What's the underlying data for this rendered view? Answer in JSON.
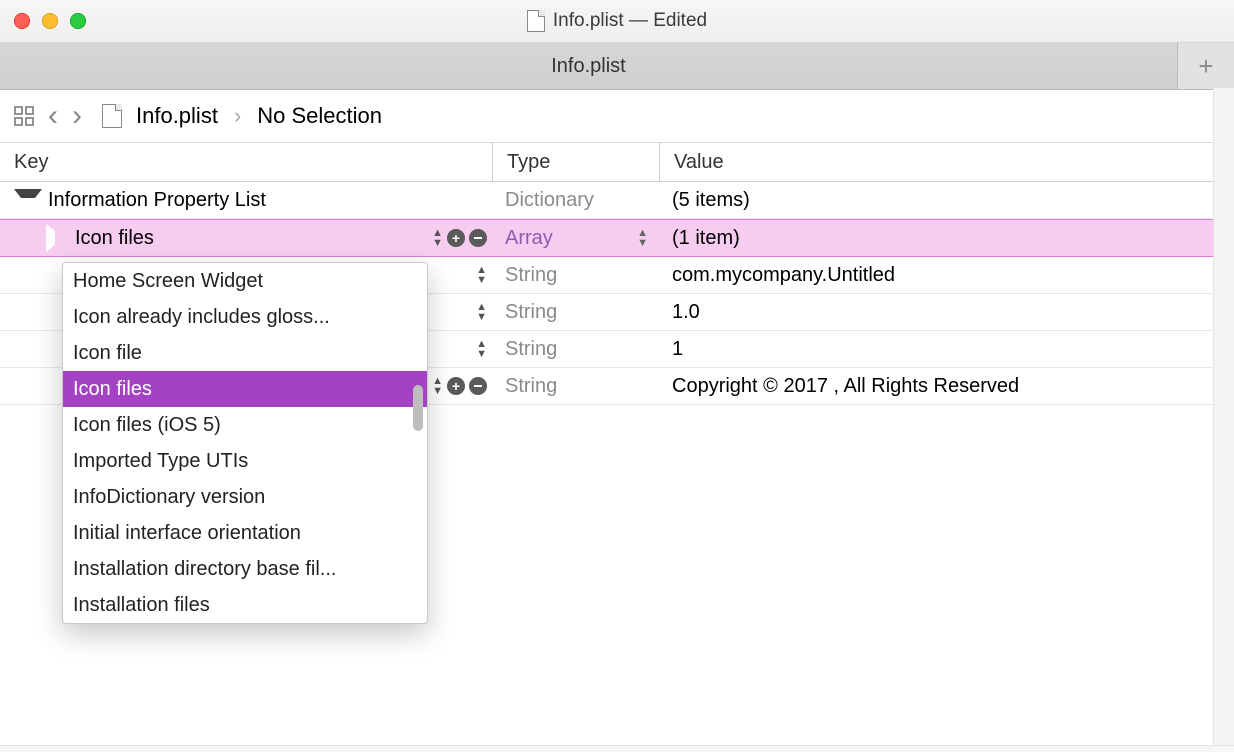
{
  "window": {
    "title": "Info.plist — Edited"
  },
  "tabbar": {
    "tab": "Info.plist"
  },
  "nav": {
    "file": "Info.plist",
    "breadcrumb": "No Selection"
  },
  "columns": {
    "key": "Key",
    "type": "Type",
    "value": "Value"
  },
  "rows": [
    {
      "key": "Information Property List",
      "type": "Dictionary",
      "value": "(5 items)",
      "indent": 0,
      "expand": "down",
      "ctrls": false,
      "typestep": false
    },
    {
      "key": "Icon files",
      "type": "Array",
      "value": "(1 item)",
      "indent": 1,
      "expand": "right",
      "ctrls": true,
      "typestep": true,
      "hl": true
    },
    {
      "key": "",
      "type": "String",
      "value": "com.mycompany.Untitled",
      "indent": 1,
      "ctrls": false,
      "typestep": false,
      "keystep": true
    },
    {
      "key": "",
      "type": "String",
      "value": "1.0",
      "indent": 1,
      "ctrls": false,
      "typestep": false,
      "keystep": true
    },
    {
      "key": "",
      "type": "String",
      "value": "1",
      "indent": 1,
      "ctrls": false,
      "typestep": false,
      "keystep": true
    },
    {
      "key": "",
      "type": "String",
      "value": "Copyright © 2017 , All Rights Reserved",
      "indent": 1,
      "ctrls": true,
      "typestep": false,
      "keystep": true
    }
  ],
  "dropdown": {
    "items": [
      "Home Screen Widget",
      "Icon already includes gloss...",
      "Icon file",
      "Icon files",
      "Icon files (iOS 5)",
      "Imported Type UTIs",
      "InfoDictionary version",
      "Initial interface orientation",
      "Installation directory base fil...",
      "Installation files"
    ],
    "selected_index": 3
  }
}
